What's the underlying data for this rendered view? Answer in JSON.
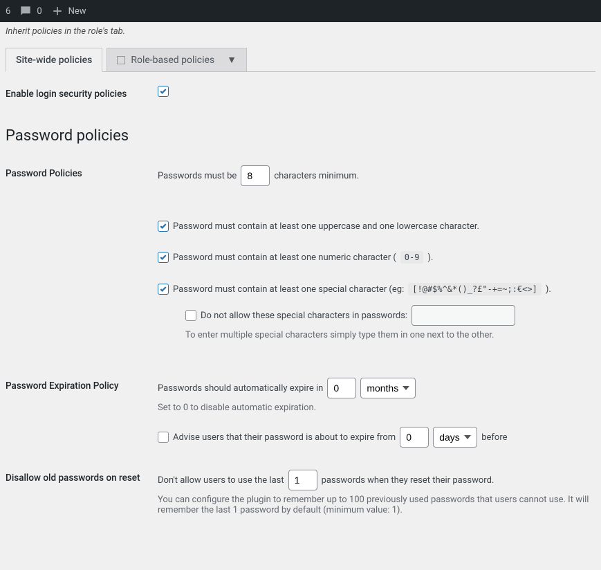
{
  "adminbar": {
    "updates_count": "6",
    "comments_count": "0",
    "new_label": "New"
  },
  "inherit_note": "Inherit policies in the role's tab.",
  "tabs": {
    "site_wide": "Site-wide policies",
    "role_based": "Role-based policies"
  },
  "enable_row": {
    "label": "Enable login security policies"
  },
  "section_title": "Password policies",
  "pw_policies": {
    "label": "Password Policies",
    "prefix": "Passwords must be",
    "value": "8",
    "suffix": "characters minimum.",
    "upper_lower": "Password must contain at least one uppercase and one lowercase character.",
    "numeric_prefix": "Password must contain at least one numeric character (",
    "numeric_code": "0-9",
    "numeric_suffix": ").",
    "special_prefix": "Password must contain at least one special character (eg:",
    "special_code": "[!@#$%^&*()_?£\"-+=~;:€<>]",
    "special_suffix": ").",
    "disallow": "Do not allow these special characters in passwords:",
    "disallow_help": "To enter multiple special characters simply type them in one next to the other."
  },
  "expiration": {
    "label": "Password Expiration Policy",
    "prefix": "Passwords should automatically expire in",
    "value": "0",
    "unit": "months",
    "help": "Set to 0 to disable automatic expiration.",
    "advise_prefix": "Advise users that their password is about to expire from",
    "advise_value": "0",
    "advise_unit": "days",
    "advise_suffix": "before"
  },
  "disallow_old": {
    "label": "Disallow old passwords on reset",
    "prefix": "Don't allow users to use the last",
    "value": "1",
    "suffix": "passwords when they reset their password.",
    "help": "You can configure the plugin to remember up to 100 previously used passwords that users cannot use. It will remember the last 1 password by default (minimum value: 1)."
  }
}
